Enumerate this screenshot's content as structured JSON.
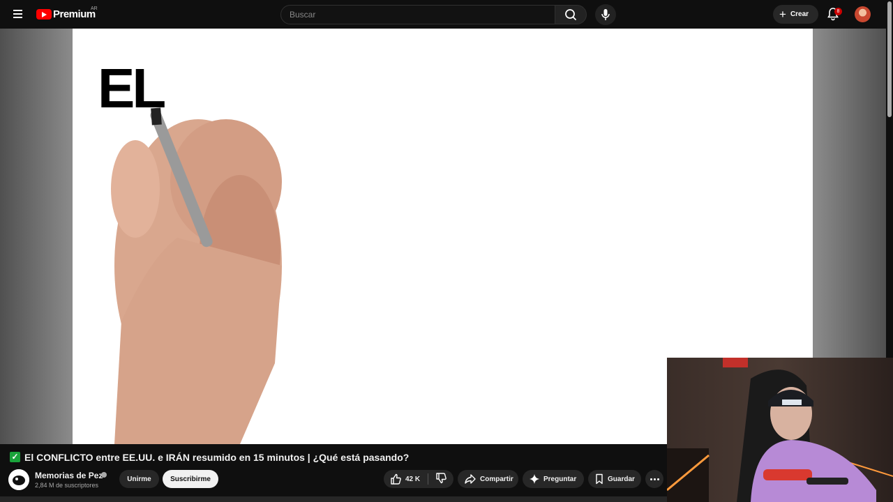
{
  "header": {
    "logo_text": "Premium",
    "country_code": "AR",
    "search_placeholder": "Buscar",
    "create_label": "Crear",
    "notification_count": "8"
  },
  "video": {
    "board_text": "EL",
    "title": "El CONFLICTO entre EE.UU. e IRÁN resumido en 15 minutos | ¿Qué está pasando?",
    "title_emoji": "✓",
    "channel": {
      "name": "Memorias de Pez",
      "subscribers": "2,84 M de suscriptores",
      "join_label": "Unirme",
      "subscribe_label": "Suscribirme"
    },
    "actions": {
      "likes": "42 K",
      "share_label": "Compartir",
      "ask_label": "Preguntar",
      "save_label": "Guardar"
    }
  },
  "colors": {
    "background": "#0f0f0f",
    "brand_red": "#ff0000",
    "pill_bg": "#272727",
    "check_green": "#1aa33b"
  }
}
